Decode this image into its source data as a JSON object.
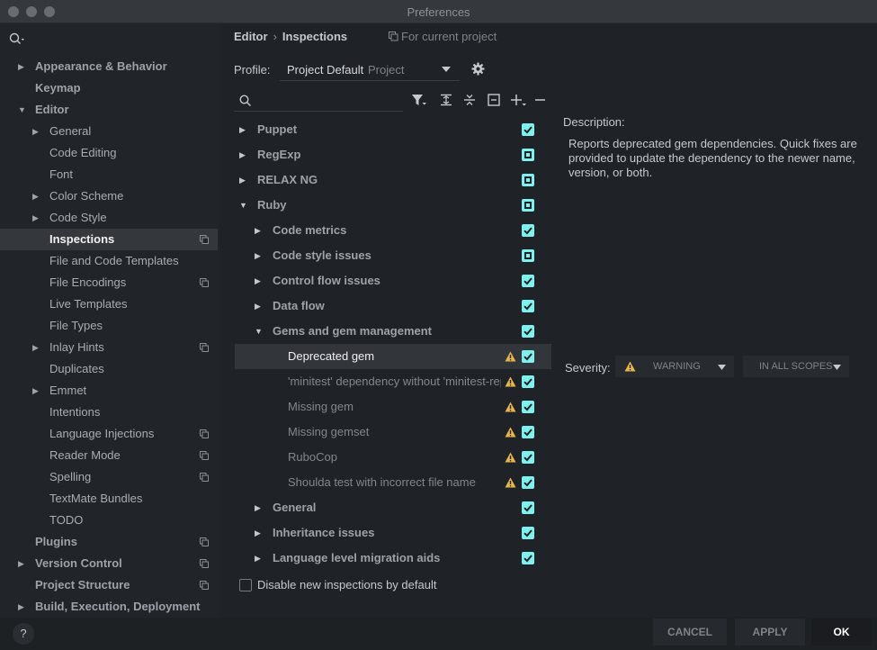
{
  "window": {
    "title": "Preferences"
  },
  "sidebar": {
    "items": [
      {
        "label": "Appearance & Behavior",
        "level": 0,
        "arrow": "right",
        "bold": true,
        "copy": false
      },
      {
        "label": "Keymap",
        "level": 0,
        "arrow": "none",
        "bold": true,
        "copy": false
      },
      {
        "label": "Editor",
        "level": 0,
        "arrow": "down",
        "bold": true,
        "copy": false
      },
      {
        "label": "General",
        "level": 1,
        "arrow": "right",
        "bold": false,
        "copy": false
      },
      {
        "label": "Code Editing",
        "level": 1,
        "arrow": "none",
        "bold": false,
        "copy": false
      },
      {
        "label": "Font",
        "level": 1,
        "arrow": "none",
        "bold": false,
        "copy": false
      },
      {
        "label": "Color Scheme",
        "level": 1,
        "arrow": "right",
        "bold": false,
        "copy": false
      },
      {
        "label": "Code Style",
        "level": 1,
        "arrow": "right",
        "bold": false,
        "copy": false
      },
      {
        "label": "Inspections",
        "level": 1,
        "arrow": "none",
        "bold": false,
        "copy": true,
        "selected": true
      },
      {
        "label": "File and Code Templates",
        "level": 1,
        "arrow": "none",
        "bold": false,
        "copy": false
      },
      {
        "label": "File Encodings",
        "level": 1,
        "arrow": "none",
        "bold": false,
        "copy": true
      },
      {
        "label": "Live Templates",
        "level": 1,
        "arrow": "none",
        "bold": false,
        "copy": false
      },
      {
        "label": "File Types",
        "level": 1,
        "arrow": "none",
        "bold": false,
        "copy": false
      },
      {
        "label": "Inlay Hints",
        "level": 1,
        "arrow": "right",
        "bold": false,
        "copy": true
      },
      {
        "label": "Duplicates",
        "level": 1,
        "arrow": "none",
        "bold": false,
        "copy": false
      },
      {
        "label": "Emmet",
        "level": 1,
        "arrow": "right",
        "bold": false,
        "copy": false
      },
      {
        "label": "Intentions",
        "level": 1,
        "arrow": "none",
        "bold": false,
        "copy": false
      },
      {
        "label": "Language Injections",
        "level": 1,
        "arrow": "none",
        "bold": false,
        "copy": true
      },
      {
        "label": "Reader Mode",
        "level": 1,
        "arrow": "none",
        "bold": false,
        "copy": true
      },
      {
        "label": "Spelling",
        "level": 1,
        "arrow": "none",
        "bold": false,
        "copy": true
      },
      {
        "label": "TextMate Bundles",
        "level": 1,
        "arrow": "none",
        "bold": false,
        "copy": false
      },
      {
        "label": "TODO",
        "level": 1,
        "arrow": "none",
        "bold": false,
        "copy": false
      },
      {
        "label": "Plugins",
        "level": 0,
        "arrow": "none",
        "bold": true,
        "copy": true
      },
      {
        "label": "Version Control",
        "level": 0,
        "arrow": "right",
        "bold": true,
        "copy": true
      },
      {
        "label": "Project Structure",
        "level": 0,
        "arrow": "none",
        "bold": true,
        "copy": true
      },
      {
        "label": "Build, Execution, Deployment",
        "level": 0,
        "arrow": "right",
        "bold": true,
        "copy": false
      }
    ]
  },
  "header": {
    "breadcrumb_parent": "Editor",
    "breadcrumb_separator": "›",
    "breadcrumb_current": "Inspections",
    "scope_note": "For current project"
  },
  "profile": {
    "label": "Profile:",
    "value": "Project Default",
    "kind": "Project"
  },
  "tree": {
    "rows": [
      {
        "label": "Puppet",
        "level": 0,
        "arrow": "right",
        "bold": true,
        "check": "checked",
        "warn": false
      },
      {
        "label": "RegExp",
        "level": 0,
        "arrow": "right",
        "bold": true,
        "check": "partial",
        "warn": false
      },
      {
        "label": "RELAX NG",
        "level": 0,
        "arrow": "right",
        "bold": true,
        "check": "partial",
        "warn": false
      },
      {
        "label": "Ruby",
        "level": 0,
        "arrow": "down",
        "bold": true,
        "check": "partial",
        "warn": false
      },
      {
        "label": "Code metrics",
        "level": 1,
        "arrow": "right",
        "bold": true,
        "check": "checked",
        "warn": false
      },
      {
        "label": "Code style issues",
        "level": 1,
        "arrow": "right",
        "bold": true,
        "check": "partial",
        "warn": false
      },
      {
        "label": "Control flow issues",
        "level": 1,
        "arrow": "right",
        "bold": true,
        "check": "checked",
        "warn": false
      },
      {
        "label": "Data flow",
        "level": 1,
        "arrow": "right",
        "bold": true,
        "check": "checked",
        "warn": false
      },
      {
        "label": "Gems and gem management",
        "level": 1,
        "arrow": "down",
        "bold": true,
        "check": "checked",
        "warn": false
      },
      {
        "label": "Deprecated gem",
        "level": 2,
        "arrow": "none",
        "bold": false,
        "check": "checked",
        "warn": true,
        "selected": true
      },
      {
        "label": "'minitest' dependency without 'minitest-reporters'",
        "level": 2,
        "arrow": "none",
        "bold": false,
        "check": "checked",
        "warn": true
      },
      {
        "label": "Missing gem",
        "level": 2,
        "arrow": "none",
        "bold": false,
        "check": "checked",
        "warn": true
      },
      {
        "label": "Missing gemset",
        "level": 2,
        "arrow": "none",
        "bold": false,
        "check": "checked",
        "warn": true
      },
      {
        "label": "RuboCop",
        "level": 2,
        "arrow": "none",
        "bold": false,
        "check": "checked",
        "warn": true
      },
      {
        "label": "Shoulda test with incorrect file name",
        "level": 2,
        "arrow": "none",
        "bold": false,
        "check": "checked",
        "warn": true
      },
      {
        "label": "General",
        "level": 1,
        "arrow": "right",
        "bold": true,
        "check": "checked",
        "warn": false
      },
      {
        "label": "Inheritance issues",
        "level": 1,
        "arrow": "right",
        "bold": true,
        "check": "checked",
        "warn": false
      },
      {
        "label": "Language level migration aids",
        "level": 1,
        "arrow": "right",
        "bold": true,
        "check": "checked",
        "warn": false
      }
    ],
    "disable_new_label": "Disable new inspections by default"
  },
  "description": {
    "title": "Description:",
    "text": "Reports deprecated gem dependencies. Quick fixes are provided to update the dependency to the newer name, version, or both."
  },
  "severity": {
    "label": "Severity:",
    "value": "WARNING",
    "scope": "IN ALL SCOPES"
  },
  "buttons": {
    "help": "?",
    "cancel": "CANCEL",
    "apply": "APPLY",
    "ok": "OK"
  },
  "colors": {
    "accent": "#7ff0ee",
    "warning": "#e8b54a",
    "background": "#1f2226"
  }
}
